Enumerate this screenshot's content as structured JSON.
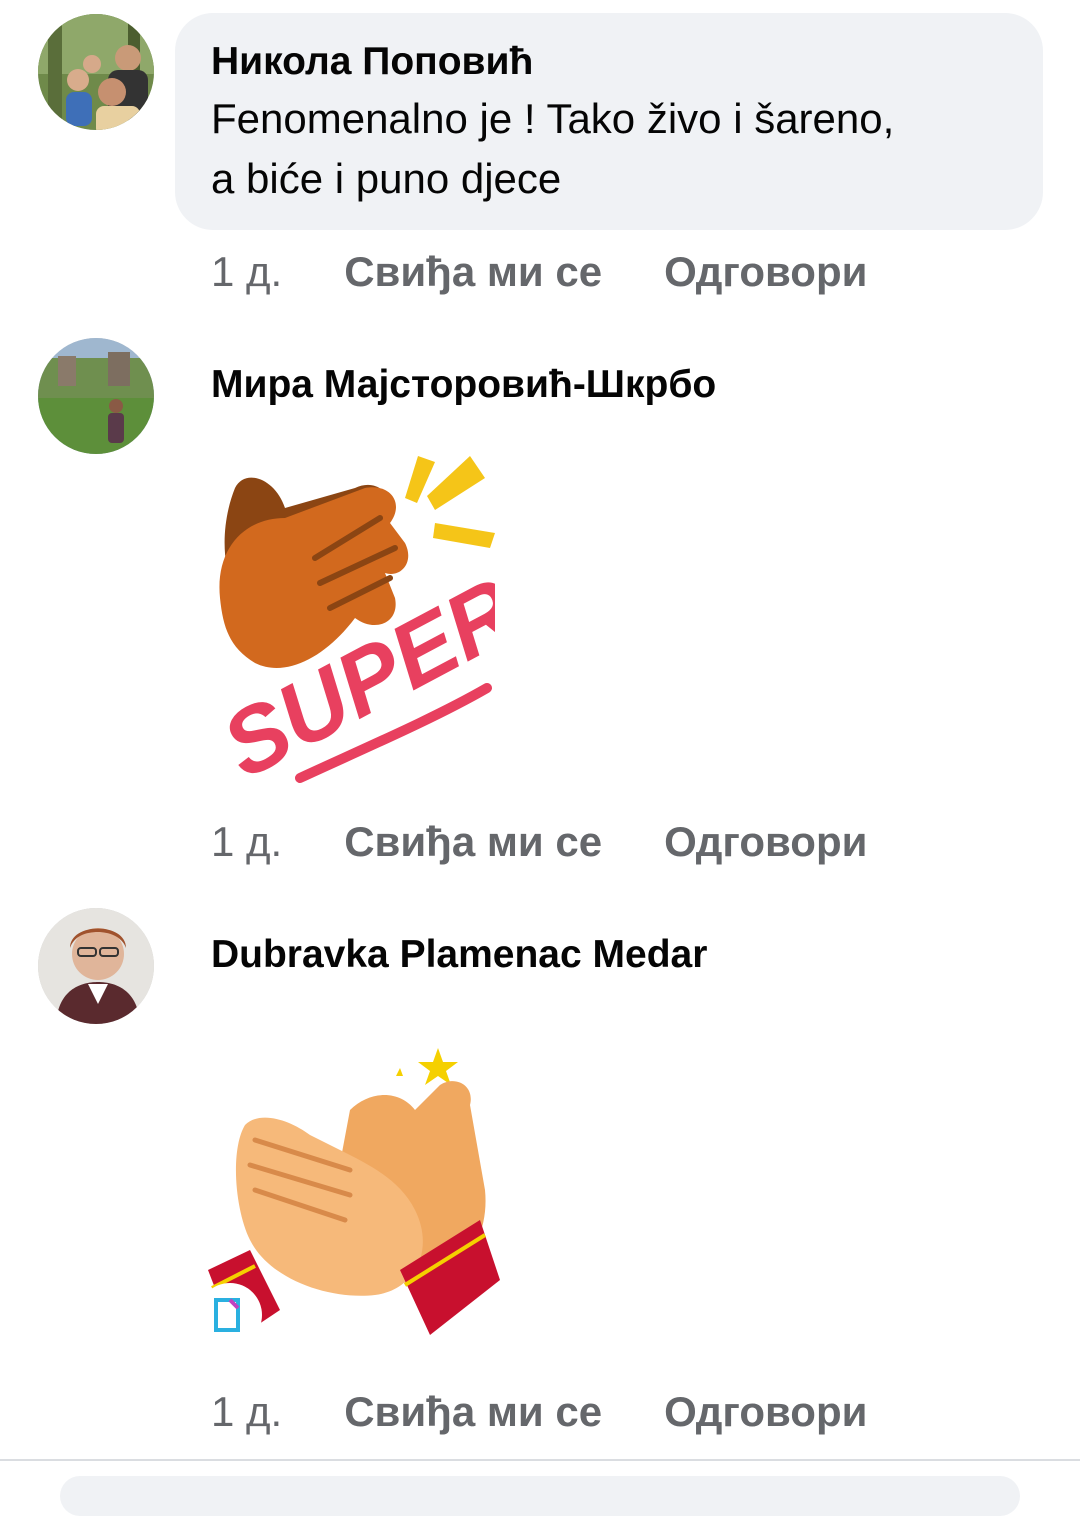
{
  "comments": [
    {
      "author": "Никола Поповић",
      "text_line1": "Fenomenalno je ! Tako živo i šareno,",
      "text_line2": "a biće i puno djece",
      "time": "1 д.",
      "like_label": "Свиђа ми се",
      "reply_label": "Одговори"
    },
    {
      "author": "Мира Мајсторовић-Шкрбо",
      "sticker_text": "SUPER!",
      "time": "1 д.",
      "like_label": "Свиђа ми се",
      "reply_label": "Одговори"
    },
    {
      "author": "Dubravka Plamenac Medar",
      "time": "1 д.",
      "like_label": "Свиђа ми се",
      "reply_label": "Одговори"
    }
  ],
  "colors": {
    "bubble_bg": "#f0f2f5",
    "secondary_text": "#65676b",
    "primary_text": "#050505",
    "super_pink": "#e8405f"
  }
}
